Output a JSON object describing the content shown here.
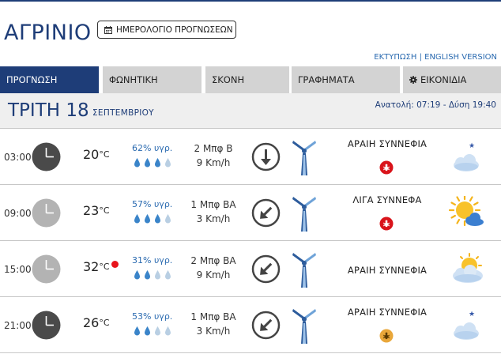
{
  "header": {
    "city": "ΑΓΡΙΝΙΟ",
    "calendar_button": "ΗΜΕΡΟΛΟΓΙΟ ΠΡΟΓΝΩΣΕΩΝ",
    "print_link": "ΕΚΤΥΠΩΣΗ",
    "separator": " | ",
    "english_link": "ENGLISH VERSION"
  },
  "tabs": [
    {
      "label": "ΠΡΟΓΝΩΣΗ",
      "active": true
    },
    {
      "label": "ΦΩΝΗΤΙΚΗ",
      "active": false
    },
    {
      "label": "ΣΚΟΝΗ",
      "active": false
    },
    {
      "label": "ΓΡΑΦΗΜΑΤΑ",
      "active": false
    },
    {
      "label": "ΕΙΚΟΝΙΔΙΑ",
      "active": false,
      "icon": "gear-icon"
    }
  ],
  "day": {
    "title": "ΤΡΙΤΗ 18",
    "month": "ΣΕΠΤΕΜΒΡΙΟΥ",
    "sun_times": "Ανατολή: 07:19  - Δύση 19:40"
  },
  "colors": {
    "brand": "#1e3d78",
    "link": "#2a6ab0",
    "tab_inactive": "#d3d3d3",
    "night_clock": "#4a4a4a",
    "day_clock": "#b3b3b3",
    "warning_red": "#d9141b",
    "warning_orange": "#e9a73a"
  },
  "forecast": [
    {
      "time": "03:00",
      "clock": "night",
      "temp": "20",
      "unit": "°C",
      "hot": false,
      "humidity": "62% υγρ.",
      "drops_filled": 3,
      "wind_bf": "2 Μπφ Β",
      "wind_kmh": "9 Km/h",
      "wind_dir": "north",
      "sky": "ΑΡΑΙΗ ΣΥΝΝΕΦΙΑ",
      "badge": "red",
      "icon": "night-cloud-icon"
    },
    {
      "time": "09:00",
      "clock": "day",
      "temp": "23",
      "unit": "°C",
      "hot": false,
      "humidity": "57% υγρ.",
      "drops_filled": 3,
      "wind_bf": "1 Μπφ ΒΑ",
      "wind_kmh": "3 Km/h",
      "wind_dir": "north-east",
      "sky": "ΛΙΓΑ ΣΥΝΝΕΦΑ",
      "badge": "red",
      "icon": "sun-cloud-icon"
    },
    {
      "time": "15:00",
      "clock": "day",
      "temp": "32",
      "unit": "°C",
      "hot": true,
      "humidity": "31% υγρ.",
      "drops_filled": 2,
      "wind_bf": "2 Μπφ ΒΑ",
      "wind_kmh": "9 Km/h",
      "wind_dir": "north-east",
      "sky": "ΑΡΑΙΗ ΣΥΝΝΕΦΙΑ",
      "badge": null,
      "icon": "sun-behind-cloud-icon"
    },
    {
      "time": "21:00",
      "clock": "night",
      "temp": "26",
      "unit": "°C",
      "hot": false,
      "humidity": "53% υγρ.",
      "drops_filled": 2,
      "wind_bf": "1 Μπφ ΒΑ",
      "wind_kmh": "3 Km/h",
      "wind_dir": "north-east",
      "sky": "ΑΡΑΙΗ ΣΥΝΝΕΦΙΑ",
      "badge": "orange",
      "icon": "night-cloud-icon"
    }
  ]
}
